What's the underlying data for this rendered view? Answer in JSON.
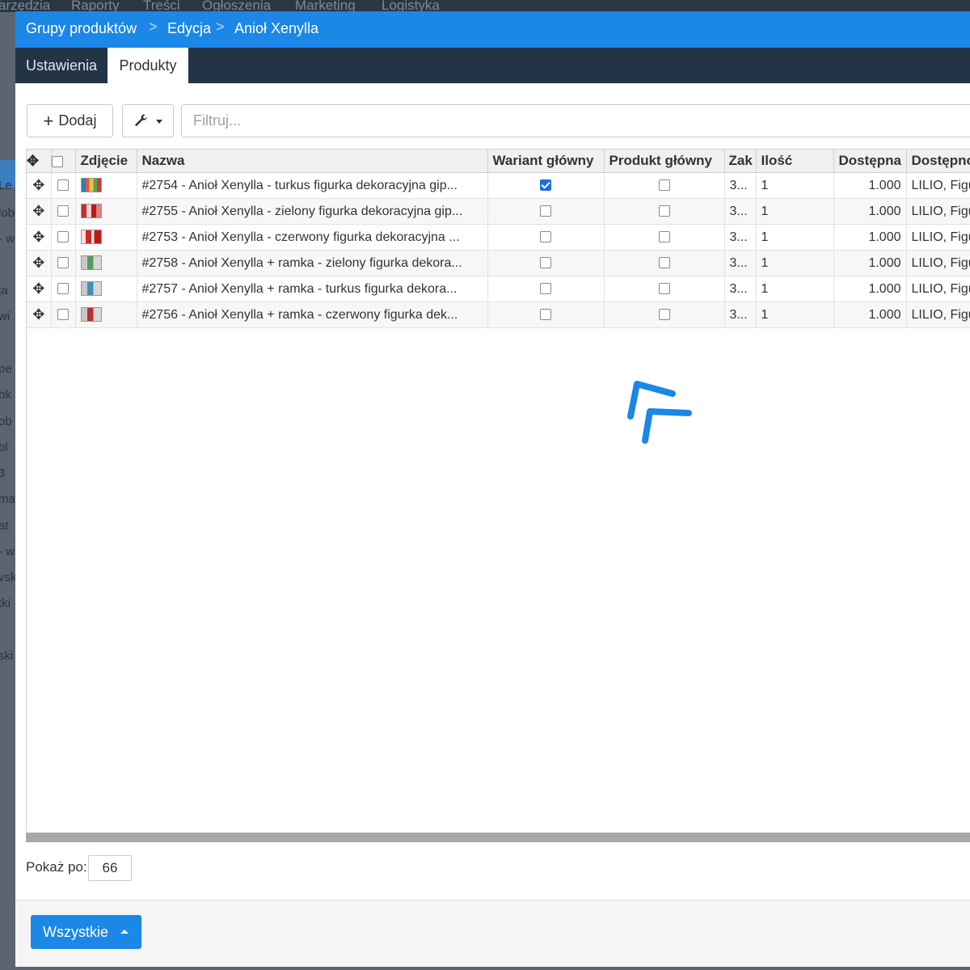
{
  "background": {
    "topnav": [
      "arzędzia",
      "Raporty",
      "Treści",
      "Ogłoszenia",
      "Marketing",
      "Logistyka"
    ],
    "sidebar_fragments": [
      "Le",
      "lob",
      "- w",
      "ja",
      "wi",
      "pe",
      "bk",
      "ob",
      "bl",
      "3",
      "ma",
      "at",
      "- w",
      "vsk",
      "tki",
      "ski"
    ]
  },
  "breadcrumb": [
    "Grupy produktów",
    "Edycja",
    "Anioł Xenylla"
  ],
  "breadcrumb_separator": ">",
  "tabs": [
    {
      "label": "Ustawienia",
      "active": false
    },
    {
      "label": "Produkty",
      "active": true
    }
  ],
  "toolbar": {
    "add_label": "Dodaj",
    "add_icon": "plus-icon",
    "tools_icon": "wrench-icon",
    "filter_placeholder": "Filtruj..."
  },
  "table": {
    "columns": [
      "",
      "",
      "Zdjęcie",
      "Nazwa",
      "Wariant główny",
      "Produkt główny",
      "Zak",
      "Ilość",
      "Dostępna",
      "Dostępno"
    ],
    "rows": [
      {
        "name": "#2754 - Anioł Xenylla - turkus figurka dekoracyjna gip...",
        "variant_main": true,
        "product_main": false,
        "zak": "3...",
        "qty": "1",
        "available": "1.000",
        "availability": "LILIO, Figu"
      },
      {
        "name": "#2755 - Anioł Xenylla - zielony figurka dekoracyjna gip...",
        "variant_main": false,
        "product_main": false,
        "zak": "3...",
        "qty": "1",
        "available": "1.000",
        "availability": "LILIO, Figu"
      },
      {
        "name": "#2753 - Anioł Xenylla - czerwony figurka dekoracyjna ...",
        "variant_main": false,
        "product_main": false,
        "zak": "3...",
        "qty": "1",
        "available": "1.000",
        "availability": "LILIO, Figu"
      },
      {
        "name": "#2758 - Anioł Xenylla + ramka - zielony figurka dekora...",
        "variant_main": false,
        "product_main": false,
        "zak": "3...",
        "qty": "1",
        "available": "1.000",
        "availability": "LILIO, Figu"
      },
      {
        "name": "#2757 - Anioł Xenylla + ramka - turkus figurka dekora...",
        "variant_main": false,
        "product_main": false,
        "zak": "3...",
        "qty": "1",
        "available": "1.000",
        "availability": "LILIO, Figu"
      },
      {
        "name": "#2756 - Anioł Xenylla + ramka - czerwony figurka dek...",
        "variant_main": false,
        "product_main": false,
        "zak": "3...",
        "qty": "1",
        "available": "1.000",
        "availability": "LILIO, Figu"
      }
    ]
  },
  "pager": {
    "label": "Pokaż po:",
    "value": "66"
  },
  "footer": {
    "all_label": "Wszystkie"
  },
  "colors": {
    "accent": "#1b87e6",
    "tabbar": "#243447",
    "checked": "#1b6fd6"
  }
}
